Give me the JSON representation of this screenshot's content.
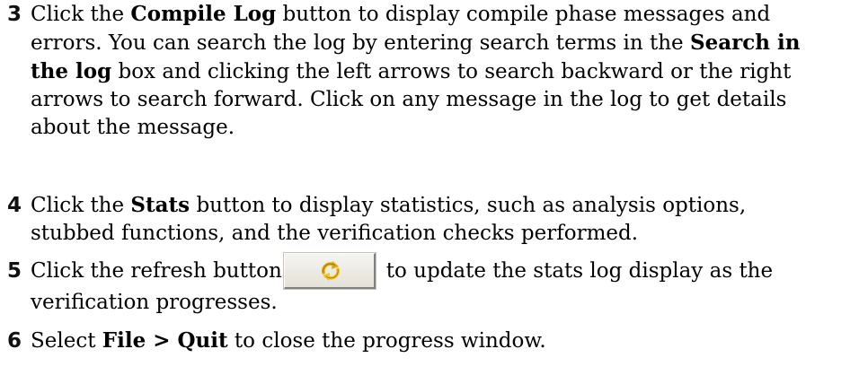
{
  "steps": [
    {
      "number": "3",
      "line1_a": "Click the ",
      "line1_b": "Compile Log",
      "line1_c": " button to display compile phase messages and",
      "line2_a": "errors. You can search the log by entering search terms in the ",
      "line2_b": "Search in",
      "line3_b": "the log",
      "line3_c": " box and clicking the left arrows to search backward or the right",
      "line4": "arrows to search forward. Click on any message in the log to get details",
      "line5": "about the message."
    },
    {
      "number": "4",
      "line1_a": "Click the ",
      "line1_b": "Stats",
      "line1_c": " button to display statistics, such as analysis options,",
      "line2": "stubbed functions, and the verification checks performed."
    },
    {
      "number": "5",
      "line1_a": "Click the refresh button",
      "line1_c": "to update the stats log display as the",
      "line2": "verification progresses.",
      "button_icon": "refresh-icon"
    },
    {
      "number": "6",
      "line1_a": "Select ",
      "line1_b": "File > Quit",
      "line1_c": " to close the progress window."
    }
  ]
}
